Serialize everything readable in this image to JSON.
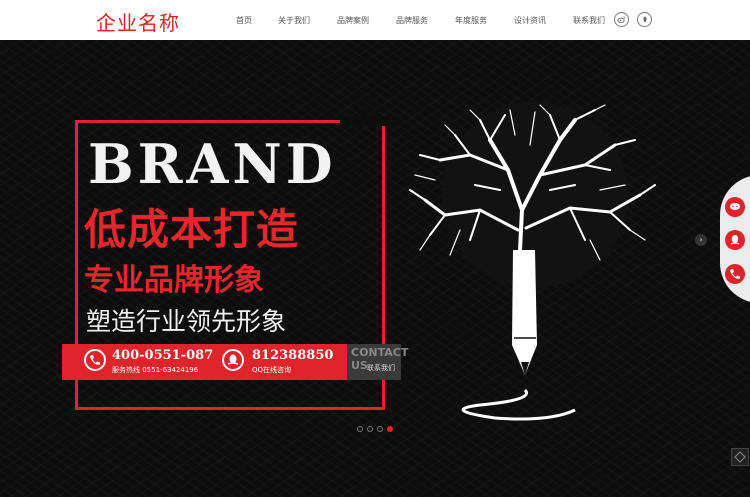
{
  "header": {
    "logo_text": "企业名称",
    "nav": [
      "首页",
      "关于我们",
      "品牌案例",
      "品牌服务",
      "年度服务",
      "设计资讯",
      "联系我们"
    ],
    "social": [
      "weibo-icon",
      "leaf-icon"
    ]
  },
  "banner": {
    "brand_word": "BRAND",
    "headline": "低成本打造",
    "subheadline": "专业品牌形象",
    "tagline": "塑造行业领先形象",
    "phone_number": "400-0551-087",
    "phone_caption": "服务热线 0551-63424196",
    "qq_number": "812388850",
    "qq_caption": "QQ在线咨询",
    "contact_title_1": "CONTACT",
    "contact_title_2": "US",
    "contact_sub": "联系我们",
    "active_slide": 4,
    "slide_count": 4
  },
  "colors": {
    "accent": "#e0242b",
    "background": "#0d0d0d",
    "header": "#ffffff"
  }
}
